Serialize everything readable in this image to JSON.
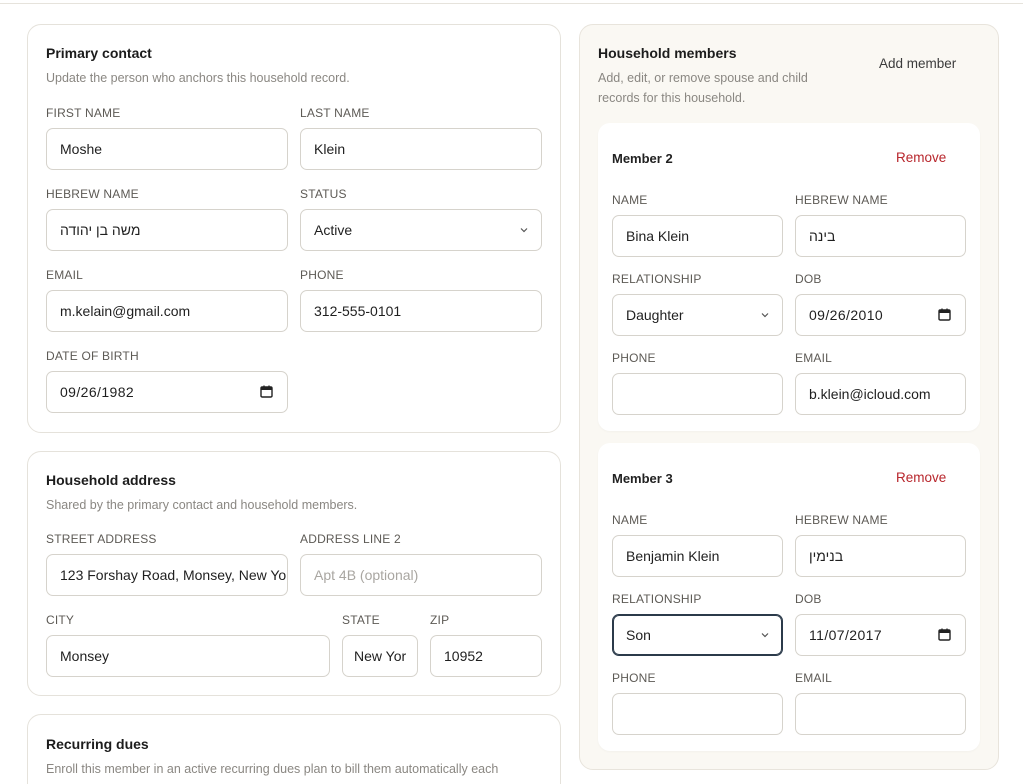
{
  "primary": {
    "title": "Primary contact",
    "subtitle": "Update the person who anchors this household record.",
    "first_name_label": "FIRST NAME",
    "first_name": "Moshe",
    "last_name_label": "LAST NAME",
    "last_name": "Klein",
    "hebrew_name_label": "HEBREW NAME",
    "hebrew_name": "משה בן יהודה",
    "status_label": "STATUS",
    "status": "Active",
    "email_label": "EMAIL",
    "email": "m.kelain@gmail.com",
    "phone_label": "PHONE",
    "phone": "312-555-0101",
    "dob_label": "DATE OF BIRTH",
    "dob": "09/26/1982"
  },
  "address": {
    "title": "Household address",
    "subtitle": "Shared by the primary contact and household members.",
    "street_label": "STREET ADDRESS",
    "street": "123 Forshay Road, Monsey, New Yo",
    "line2_label": "ADDRESS LINE 2",
    "line2_placeholder": "Apt 4B (optional)",
    "city_label": "CITY",
    "city": "Monsey",
    "state_label": "STATE",
    "state": "New Yor",
    "zip_label": "ZIP",
    "zip": "10952"
  },
  "dues": {
    "title": "Recurring dues",
    "subtitle": "Enroll this member in an active recurring dues plan to bill them automatically each"
  },
  "household": {
    "title": "Household members",
    "subtitle_line1": "Add, edit, or remove spouse and child",
    "subtitle_line2": "records for this household.",
    "add_label": "Add member",
    "remove_label": "Remove",
    "name_label": "NAME",
    "hebrew_label": "HEBREW NAME",
    "relationship_label": "RELATIONSHIP",
    "dob_label": "DOB",
    "phone_label": "PHONE",
    "email_label": "EMAIL",
    "members": [
      {
        "title": "Member 2",
        "name": "Bina Klein",
        "hebrew": "בינה",
        "relationship": "Daughter",
        "dob": "09/26/2010",
        "phone": "",
        "email": "b.klein@icloud.com"
      },
      {
        "title": "Member 3",
        "name": "Benjamin Klein",
        "hebrew": "בנימין",
        "relationship": "Son",
        "dob": "11/07/2017",
        "phone": "",
        "email": ""
      }
    ]
  },
  "colors": {
    "remove": "#b8262c",
    "panel_bg": "#faf8f3",
    "focus": "#2b3a4a"
  },
  "icons": [
    "chevron-down-icon",
    "calendar-icon"
  ]
}
